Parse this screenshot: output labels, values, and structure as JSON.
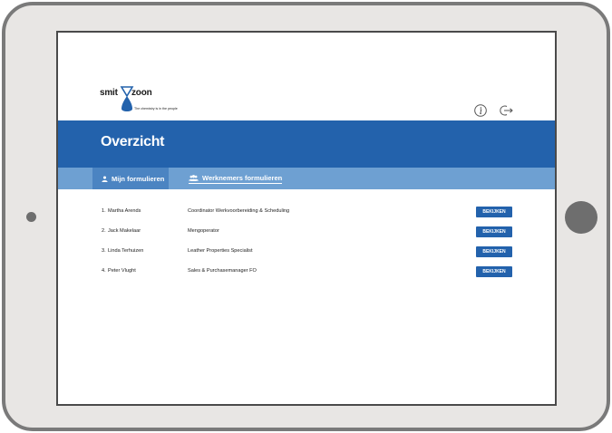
{
  "brand": {
    "word_left": "smit",
    "word_right": "zoon",
    "tagline": "The chemistry is in the people",
    "color": "#2362ac"
  },
  "header": {
    "icons": [
      "info-icon",
      "logout-icon"
    ]
  },
  "page": {
    "title": "Overzicht"
  },
  "tabs": [
    {
      "label": "Mijn formulieren",
      "icon": "user-icon",
      "active": true
    },
    {
      "label": "Werknemers formulieren",
      "icon": "users-icon",
      "active": false
    }
  ],
  "employees": [
    {
      "num": "1.",
      "name": "Martha Arends",
      "role": "Coordinator Werkvoorbereiding & Scheduling",
      "button": "BEKIJKEN"
    },
    {
      "num": "2.",
      "name": "Jack Makelaar",
      "role": "Mengoperator",
      "button": "BEKIJKEN"
    },
    {
      "num": "3.",
      "name": "Linda Terhuizen",
      "role": "Leather Properties Specialist",
      "button": "BEKIJKEN"
    },
    {
      "num": "4.",
      "name": "Peter Vlught",
      "role": "Sales & Purchasemanager FO",
      "button": "BEKIJKEN"
    }
  ],
  "colors": {
    "title_band": "#2362ac",
    "tab_bar": "#6ea0d2",
    "tab_active": "#4b84c2",
    "button": "#2362ac",
    "device_frame": "#7a7a7a"
  }
}
